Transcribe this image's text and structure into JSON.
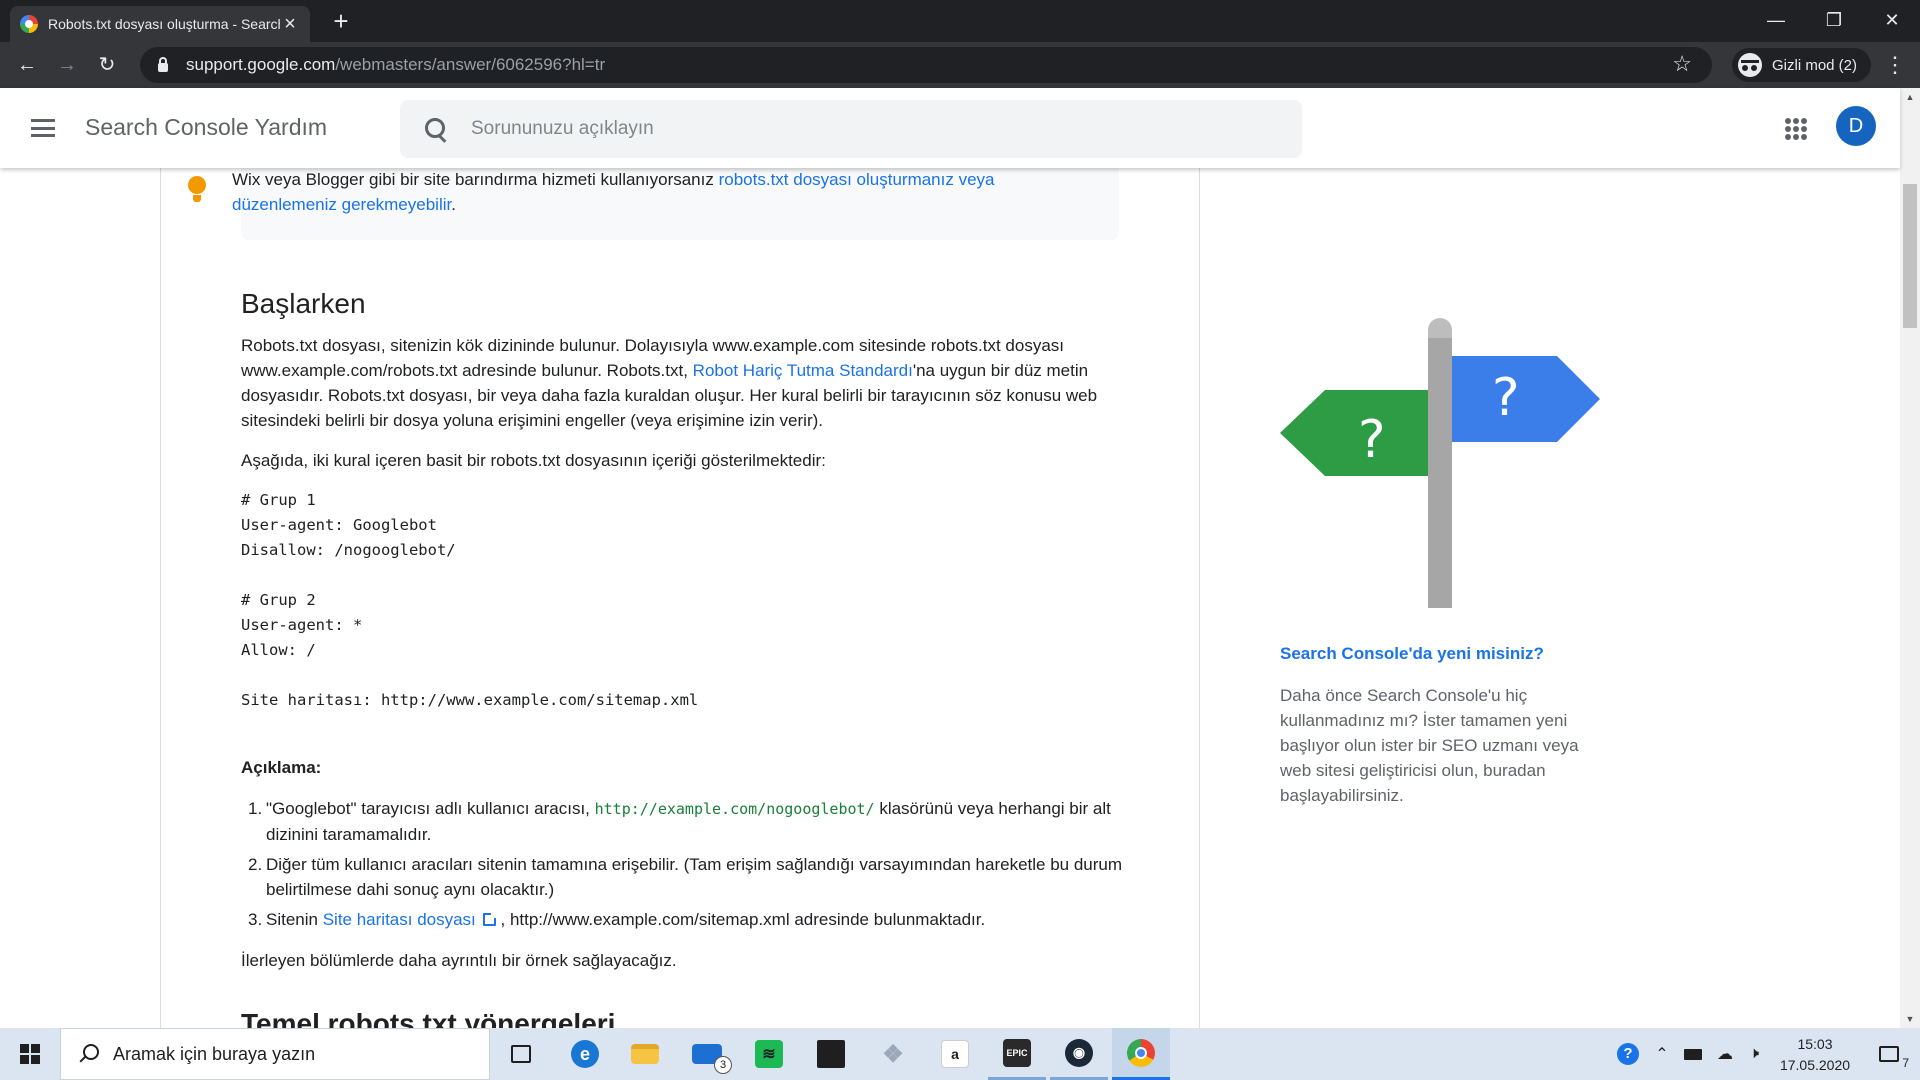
{
  "browser": {
    "tab_title": "Robots.txt dosyası oluşturma - Search Console Yardım",
    "url_host": "support.google.com",
    "url_path": "/webmasters/answer/6062596?hl=tr",
    "incognito_label": "Gizli mod (2)"
  },
  "header": {
    "title": "Search Console Yardım",
    "search_placeholder": "Sorununuzu açıklayın",
    "avatar_letter": "D"
  },
  "callout": {
    "text": "Wix veya Blogger gibi bir site barındırma hizmeti kullanıyorsanız ",
    "link": "robots.txt dosyası oluşturmanız veya düzenlemeniz gerekmeyebilir",
    "suffix": "."
  },
  "article": {
    "section_title": "Başlarken",
    "intro_1": "Robots.txt dosyası, sitenizin kök dizininde bulunur. Dolayısıyla www.example.com sitesinde robots.txt dosyası www.example.com/robots.txt adresinde bulunur. Robots.txt, ",
    "intro_link": "Robot Hariç Tutma Standardı",
    "intro_2": "'na uygun bir düz metin dosyasıdır. Robots.txt dosyası, bir veya daha fazla kuraldan oluşur. Her kural belirli bir tarayıcının söz konusu web sitesindeki belirli bir dosya yoluna erişimini engeller (veya erişimine izin verir).",
    "example_intro": "Aşağıda, iki kural içeren basit bir robots.txt dosyasının içeriği gösterilmektedir:",
    "code": "# Grup 1\nUser-agent: Googlebot\nDisallow: /nogooglebot/\n\n# Grup 2\nUser-agent: *\nAllow: /\n\nSite haritası: http://www.example.com/sitemap.xml",
    "explanation_label": "Açıklama:",
    "notes": [
      {
        "num": "1.",
        "pre": "\"Googlebot\" tarayıcısı adlı kullanıcı aracısı, ",
        "code": "http://example.com/nogooglebot/",
        "post": " klasörünü veya herhangi bir alt dizinini taramamalıdır."
      },
      {
        "num": "2.",
        "text": "Diğer tüm kullanıcı aracıları sitenin tamamına erişebilir. (Tam erişim sağlandığı varsayımından hareketle bu durum belirtilmese dahi sonuç aynı olacaktır.)"
      },
      {
        "num": "3.",
        "pre": "Sitenin ",
        "link": "Site haritası dosyası",
        "post": " , http://www.example.com/sitemap.xml adresinde bulunmaktadır."
      }
    ],
    "closing": "İlerleyen bölümlerde daha ayrıntılı bir örnek sağlayacağız.",
    "next_heading": "Temel robots.txt yönergeleri"
  },
  "promo": {
    "sign_mark": "?",
    "title": "Search Console'da yeni misiniz?",
    "text": "Daha önce Search Console'u hiç kullanmadınız mı? İster tamamen yeni başlıyor olun ister bir SEO uzmanı veya web sitesi geliştiricisi olun, buradan başlayabilirsiniz."
  },
  "taskbar": {
    "search_text": "Aramak için buraya yazın",
    "mail_badge": "3",
    "time": "15:03",
    "date": "17.05.2020",
    "notification_count": "7"
  },
  "colors": {
    "link": "#1a73e8",
    "sign_green": "#2e9b45",
    "sign_blue": "#3b7de9",
    "avatar": "#1565c0"
  }
}
